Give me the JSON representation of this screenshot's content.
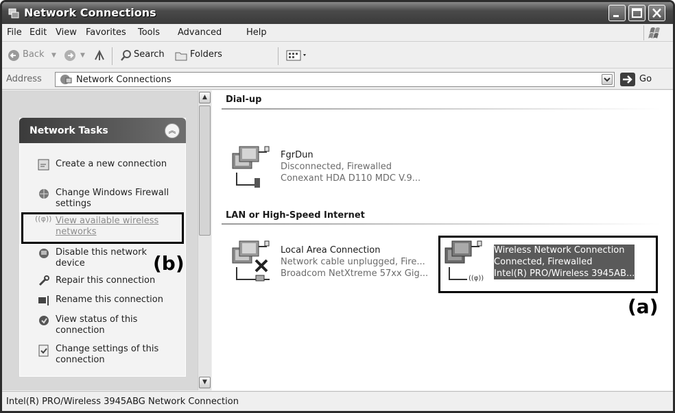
{
  "window": {
    "title": "Network Connections"
  },
  "menu": {
    "items": [
      "File",
      "Edit",
      "View",
      "Favorites",
      "Tools",
      "Advanced",
      "Help"
    ]
  },
  "toolbar": {
    "back": "Back",
    "search": "Search",
    "folders": "Folders"
  },
  "address": {
    "label": "Address",
    "value": "Network Connections",
    "go": "Go"
  },
  "tasks": {
    "title": "Network Tasks",
    "items": [
      {
        "label": "Create a new connection",
        "icon": "new-connection-icon"
      },
      {
        "label": "Change Windows Firewall settings",
        "icon": "firewall-icon"
      },
      {
        "label": "View available wireless networks",
        "icon": "wireless-icon"
      },
      {
        "label": "Disable this network device",
        "icon": "disable-icon"
      },
      {
        "label": "Repair this connection",
        "icon": "repair-icon"
      },
      {
        "label": "Rename this connection",
        "icon": "rename-icon"
      },
      {
        "label": "View status of this connection",
        "icon": "status-icon"
      },
      {
        "label": "Change settings of this connection",
        "icon": "settings-icon"
      }
    ]
  },
  "groups": {
    "dialup": {
      "title": "Dial-up",
      "items": [
        {
          "name": "FgrDun",
          "status": "Disconnected, Firewalled",
          "device": "Conexant HDA D110 MDC V.9..."
        }
      ]
    },
    "lan": {
      "title": "LAN or High-Speed Internet",
      "items": [
        {
          "name": "Local Area Connection",
          "status": "Network cable unplugged, Fire...",
          "device": "Broadcom NetXtreme 57xx Gig..."
        },
        {
          "name": "Wireless Network Connection",
          "status": "Connected, Firewalled",
          "device": "Intel(R) PRO/Wireless 3945AB..."
        }
      ]
    }
  },
  "annotations": {
    "a": "(a)",
    "b": "(b)"
  },
  "status": {
    "text": "Intel(R) PRO/Wireless 3945ABG Network Connection"
  }
}
